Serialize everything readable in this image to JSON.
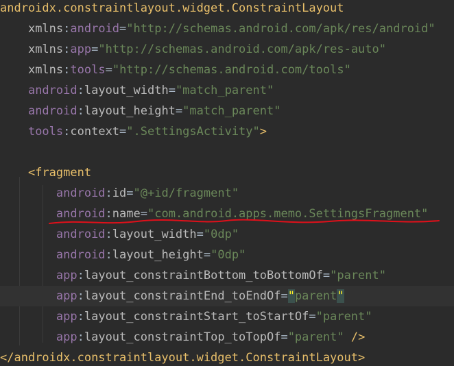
{
  "code": {
    "lines": [
      {
        "indent": "",
        "tokens": [
          {
            "t": "tag",
            "v": "androidx.constraintlayout.widget.ConstraintLayout"
          }
        ]
      },
      {
        "indent": "    ",
        "tokens": [
          {
            "t": "attr",
            "v": "xmlns"
          },
          {
            "t": "punct",
            "v": ":"
          },
          {
            "t": "ns",
            "v": "android"
          },
          {
            "t": "punct",
            "v": "="
          },
          {
            "t": "val",
            "v": "\"http://schemas.android.com/apk/res/android\""
          }
        ]
      },
      {
        "indent": "    ",
        "tokens": [
          {
            "t": "attr",
            "v": "xmlns"
          },
          {
            "t": "punct",
            "v": ":"
          },
          {
            "t": "ns",
            "v": "app"
          },
          {
            "t": "punct",
            "v": "="
          },
          {
            "t": "val",
            "v": "\"http://schemas.android.com/apk/res-auto\""
          }
        ]
      },
      {
        "indent": "    ",
        "tokens": [
          {
            "t": "attr",
            "v": "xmlns"
          },
          {
            "t": "punct",
            "v": ":"
          },
          {
            "t": "ns",
            "v": "tools"
          },
          {
            "t": "punct",
            "v": "="
          },
          {
            "t": "val",
            "v": "\"http://schemas.android.com/tools\""
          }
        ]
      },
      {
        "indent": "    ",
        "tokens": [
          {
            "t": "ns",
            "v": "android"
          },
          {
            "t": "punct",
            "v": ":"
          },
          {
            "t": "attr",
            "v": "layout_width"
          },
          {
            "t": "punct",
            "v": "="
          },
          {
            "t": "val",
            "v": "\"match_parent\""
          }
        ]
      },
      {
        "indent": "    ",
        "tokens": [
          {
            "t": "ns",
            "v": "android"
          },
          {
            "t": "punct",
            "v": ":"
          },
          {
            "t": "attr",
            "v": "layout_height"
          },
          {
            "t": "punct",
            "v": "="
          },
          {
            "t": "val",
            "v": "\"match_parent\""
          }
        ]
      },
      {
        "indent": "    ",
        "tokens": [
          {
            "t": "ns",
            "v": "tools"
          },
          {
            "t": "punct",
            "v": ":"
          },
          {
            "t": "attr",
            "v": "context"
          },
          {
            "t": "punct",
            "v": "="
          },
          {
            "t": "val",
            "v": "\".SettingsActivity\""
          },
          {
            "t": "bracket",
            "v": ">"
          }
        ]
      },
      {
        "indent": "",
        "tokens": []
      },
      {
        "indent": "    ",
        "tokens": [
          {
            "t": "bracket",
            "v": "<"
          },
          {
            "t": "tag",
            "v": "fragment"
          }
        ]
      },
      {
        "indent": "        ",
        "tokens": [
          {
            "t": "ns",
            "v": "android"
          },
          {
            "t": "punct",
            "v": ":"
          },
          {
            "t": "attr",
            "v": "id"
          },
          {
            "t": "punct",
            "v": "="
          },
          {
            "t": "val",
            "v": "\"@+id/fragment\""
          }
        ]
      },
      {
        "indent": "        ",
        "tokens": [
          {
            "t": "ns",
            "v": "android"
          },
          {
            "t": "punct",
            "v": ":"
          },
          {
            "t": "attr",
            "v": "name"
          },
          {
            "t": "punct",
            "v": "="
          },
          {
            "t": "val",
            "v": "\"com.android.apps.memo.SettingsFragment\""
          }
        ]
      },
      {
        "indent": "        ",
        "tokens": [
          {
            "t": "ns",
            "v": "android"
          },
          {
            "t": "punct",
            "v": ":"
          },
          {
            "t": "attr",
            "v": "layout_width"
          },
          {
            "t": "punct",
            "v": "="
          },
          {
            "t": "val",
            "v": "\"0dp\""
          }
        ]
      },
      {
        "indent": "        ",
        "tokens": [
          {
            "t": "ns",
            "v": "android"
          },
          {
            "t": "punct",
            "v": ":"
          },
          {
            "t": "attr",
            "v": "layout_height"
          },
          {
            "t": "punct",
            "v": "="
          },
          {
            "t": "val",
            "v": "\"0dp\""
          }
        ]
      },
      {
        "indent": "        ",
        "tokens": [
          {
            "t": "ns",
            "v": "app"
          },
          {
            "t": "punct",
            "v": ":"
          },
          {
            "t": "attr",
            "v": "layout_constraintBottom_toBottomOf"
          },
          {
            "t": "punct",
            "v": "="
          },
          {
            "t": "val",
            "v": "\"parent\""
          }
        ]
      },
      {
        "indent": "        ",
        "caret": true,
        "tokens": [
          {
            "t": "ns",
            "v": "app"
          },
          {
            "t": "punct",
            "v": ":"
          },
          {
            "t": "attr",
            "v": "layout_constraintEnd_toEndOf"
          },
          {
            "t": "punct",
            "v": "="
          },
          {
            "t": "hl",
            "v": "\""
          },
          {
            "t": "val",
            "v": "parent"
          },
          {
            "t": "hl",
            "v": "\""
          }
        ]
      },
      {
        "indent": "        ",
        "tokens": [
          {
            "t": "ns",
            "v": "app"
          },
          {
            "t": "punct",
            "v": ":"
          },
          {
            "t": "attr",
            "v": "layout_constraintStart_toStartOf"
          },
          {
            "t": "punct",
            "v": "="
          },
          {
            "t": "val",
            "v": "\"parent\""
          }
        ]
      },
      {
        "indent": "        ",
        "tokens": [
          {
            "t": "ns",
            "v": "app"
          },
          {
            "t": "punct",
            "v": ":"
          },
          {
            "t": "attr",
            "v": "layout_constraintTop_toTopOf"
          },
          {
            "t": "punct",
            "v": "="
          },
          {
            "t": "val",
            "v": "\"parent\""
          },
          {
            "t": "punct",
            "v": " "
          },
          {
            "t": "bracket",
            "v": "/>"
          }
        ]
      },
      {
        "indent": "",
        "tokens": [
          {
            "t": "bracket",
            "v": "</"
          },
          {
            "t": "tag",
            "v": "androidx.constraintlayout.widget.ConstraintLayout"
          },
          {
            "t": "bracket",
            "v": ">"
          }
        ]
      }
    ]
  },
  "colors": {
    "background": "#2b2b2b",
    "tag": "#e8bf6a",
    "namespace": "#9876aa",
    "attribute": "#bababa",
    "string": "#6a8759",
    "annotation_underline": "#e0101a"
  }
}
